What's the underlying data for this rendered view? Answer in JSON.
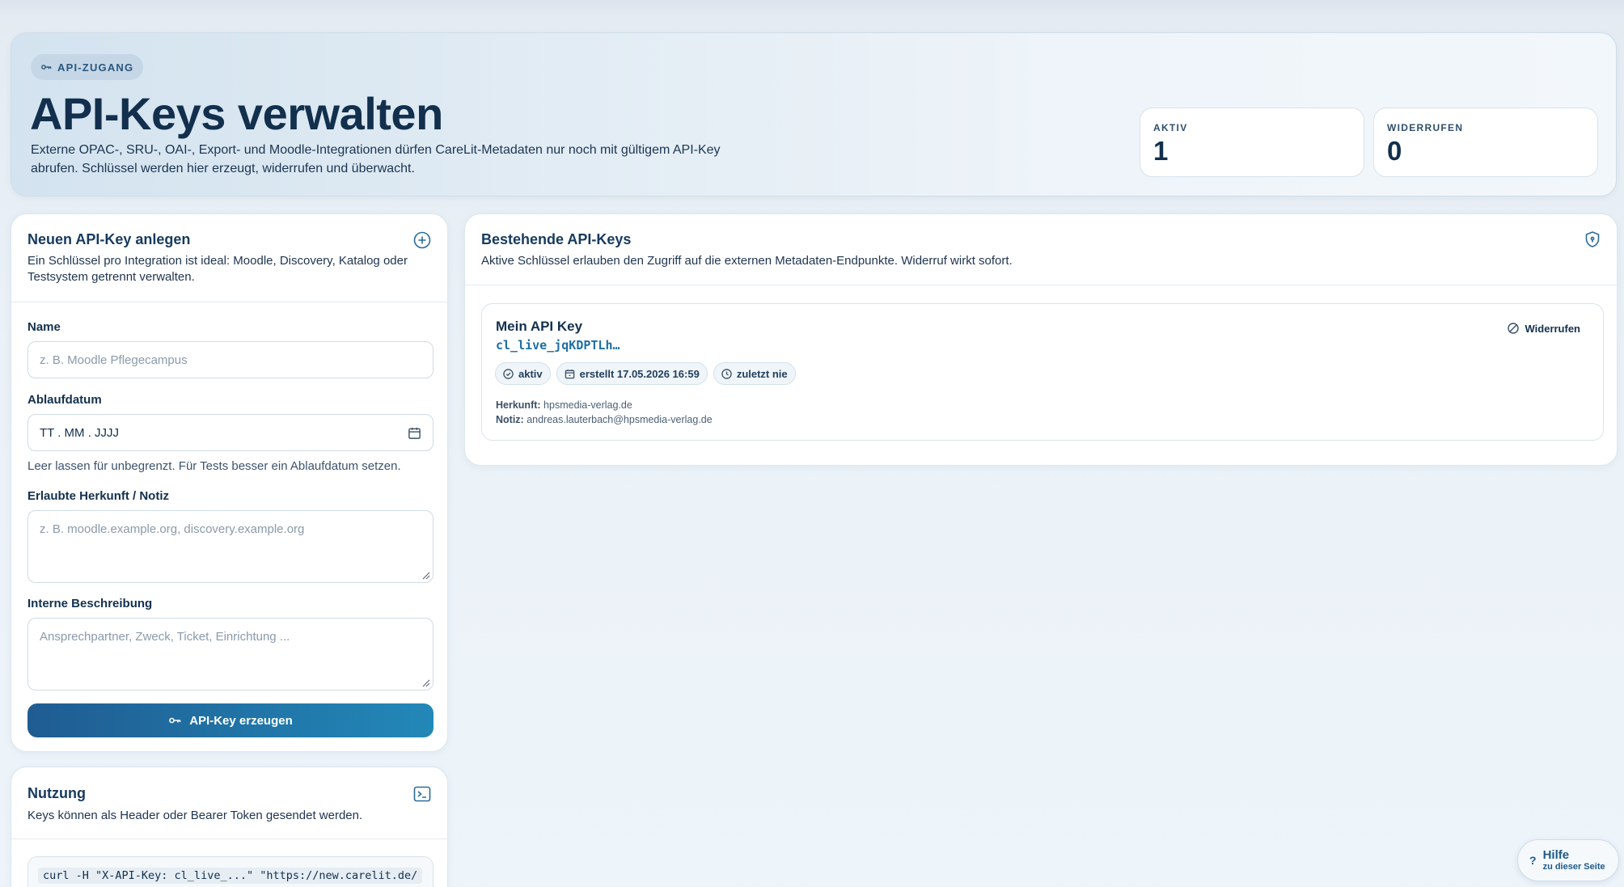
{
  "hero": {
    "badge": "API-ZUGANG",
    "title": "API-Keys verwalten",
    "description": "Externe OPAC-, SRU-, OAI-, Export- und Moodle-Integrationen dürfen CareLit-Metadaten nur noch mit gültigem API-Key abrufen. Schlüssel werden hier erzeugt, widerrufen und überwacht.",
    "stats": [
      {
        "label": "AKTIV",
        "value": "1"
      },
      {
        "label": "WIDERRUFEN",
        "value": "0"
      }
    ]
  },
  "create_form": {
    "title": "Neuen API-Key anlegen",
    "subtitle": "Ein Schlüssel pro Integration ist ideal: Moodle, Discovery, Katalog oder Testsystem getrennt verwalten.",
    "name_label": "Name",
    "name_placeholder": "z. B. Moodle Pflegecampus",
    "expiry_label": "Ablaufdatum",
    "expiry_value": "TT . MM . JJJJ",
    "expiry_hint": "Leer lassen für unbegrenzt. Für Tests besser ein Ablaufdatum setzen.",
    "origin_label": "Erlaubte Herkunft / Notiz",
    "origin_placeholder": "z. B. moodle.example.org, discovery.example.org",
    "description_label": "Interne Beschreibung",
    "description_placeholder": "Ansprechpartner, Zweck, Ticket, Einrichtung ...",
    "submit_label": "API-Key erzeugen"
  },
  "usage": {
    "title": "Nutzung",
    "subtitle": "Keys können als Header oder Bearer Token gesendet werden.",
    "code": "curl -H \"X-API-Key: cl_live_...\" \"https://new.carelit.de/"
  },
  "keys_panel": {
    "title": "Bestehende API-Keys",
    "subtitle": "Aktive Schlüssel erlauben den Zugriff auf die externen Metadaten-Endpunkte. Widerruf wirkt sofort.",
    "keys": [
      {
        "name": "Mein API Key",
        "key_prefix": "cl_live_jqKDPTLh…",
        "status": "aktiv",
        "created": "erstellt 17.05.2026 16:59",
        "last_used": "zuletzt nie",
        "origin_label": "Herkunft:",
        "origin_value": "hpsmedia-verlag.de",
        "note_label": "Notiz:",
        "note_value": "andreas.lauterbach@hpsmedia-verlag.de",
        "revoke_label": "Widerrufen"
      }
    ]
  },
  "help": {
    "icon": "?",
    "title": "Hilfe",
    "subtitle": "zu dieser Seite"
  },
  "colors": {
    "accent": "#1f5c92",
    "accent_light": "#2288b8",
    "key_code": "#1e6fa5"
  }
}
